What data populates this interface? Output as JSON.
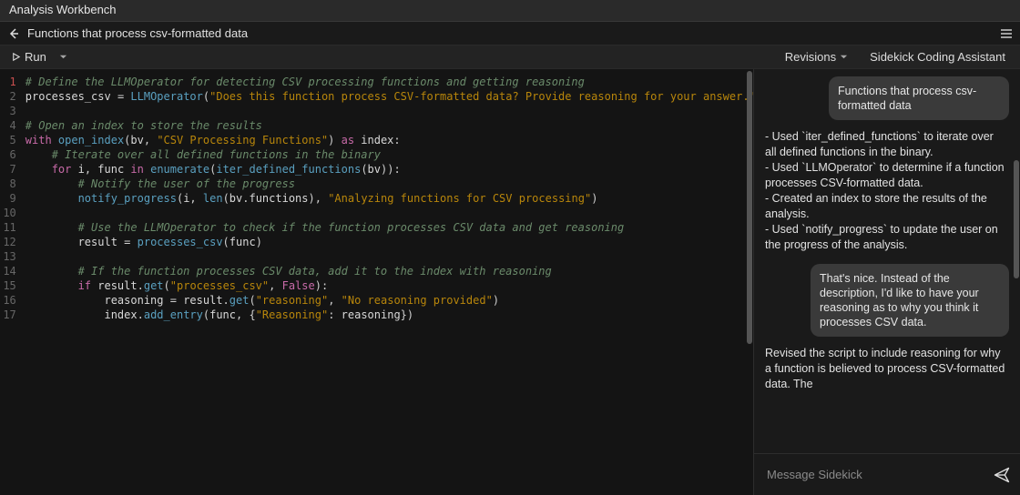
{
  "app": {
    "title": "Analysis Workbench"
  },
  "doc": {
    "title": "Functions that process csv-formatted data"
  },
  "toolbar": {
    "run_label": "Run",
    "revisions_label": "Revisions",
    "assistant_title": "Sidekick Coding Assistant"
  },
  "code_lines": [
    [
      [
        "com",
        "# Define the LLMOperator for detecting CSV processing functions and getting reasoning"
      ]
    ],
    [
      [
        "id",
        "processes_csv "
      ],
      [
        "op",
        "="
      ],
      [
        "id",
        " "
      ],
      [
        "fn",
        "LLMOperator"
      ],
      [
        "op",
        "("
      ],
      [
        "str",
        "\"Does this function process CSV-formatted data? Provide reasoning for your answer.\""
      ],
      [
        "op",
        ")"
      ]
    ],
    [],
    [
      [
        "com",
        "# Open an index to store the results"
      ]
    ],
    [
      [
        "kw",
        "with"
      ],
      [
        "id",
        " "
      ],
      [
        "fn",
        "open_index"
      ],
      [
        "op",
        "("
      ],
      [
        "id",
        "bv"
      ],
      [
        "op",
        ", "
      ],
      [
        "str",
        "\"CSV Processing Functions\""
      ],
      [
        "op",
        ") "
      ],
      [
        "kw",
        "as"
      ],
      [
        "id",
        " index"
      ],
      [
        "op",
        ":"
      ]
    ],
    [
      [
        "id",
        "    "
      ],
      [
        "com",
        "# Iterate over all defined functions in the binary"
      ]
    ],
    [
      [
        "id",
        "    "
      ],
      [
        "kw",
        "for"
      ],
      [
        "id",
        " i"
      ],
      [
        "op",
        ", "
      ],
      [
        "id",
        "func "
      ],
      [
        "kw",
        "in"
      ],
      [
        "id",
        " "
      ],
      [
        "fn",
        "enumerate"
      ],
      [
        "op",
        "("
      ],
      [
        "fn",
        "iter_defined_functions"
      ],
      [
        "op",
        "("
      ],
      [
        "id",
        "bv"
      ],
      [
        "op",
        ")):"
      ]
    ],
    [
      [
        "id",
        "        "
      ],
      [
        "com",
        "# Notify the user of the progress"
      ]
    ],
    [
      [
        "id",
        "        "
      ],
      [
        "fn",
        "notify_progress"
      ],
      [
        "op",
        "("
      ],
      [
        "id",
        "i"
      ],
      [
        "op",
        ", "
      ],
      [
        "fn",
        "len"
      ],
      [
        "op",
        "("
      ],
      [
        "id",
        "bv"
      ],
      [
        "op",
        "."
      ],
      [
        "id",
        "functions"
      ],
      [
        "op",
        "), "
      ],
      [
        "str",
        "\"Analyzing functions for CSV processing\""
      ],
      [
        "op",
        ")"
      ]
    ],
    [],
    [
      [
        "id",
        "        "
      ],
      [
        "com",
        "# Use the LLMOperator to check if the function processes CSV data and get reasoning"
      ]
    ],
    [
      [
        "id",
        "        "
      ],
      [
        "id",
        "result "
      ],
      [
        "op",
        "="
      ],
      [
        "id",
        " "
      ],
      [
        "fn",
        "processes_csv"
      ],
      [
        "op",
        "("
      ],
      [
        "id",
        "func"
      ],
      [
        "op",
        ")"
      ]
    ],
    [],
    [
      [
        "id",
        "        "
      ],
      [
        "com",
        "# If the function processes CSV data, add it to the index with reasoning"
      ]
    ],
    [
      [
        "id",
        "        "
      ],
      [
        "kw",
        "if"
      ],
      [
        "id",
        " result"
      ],
      [
        "op",
        "."
      ],
      [
        "fn",
        "get"
      ],
      [
        "op",
        "("
      ],
      [
        "str",
        "\"processes_csv\""
      ],
      [
        "op",
        ", "
      ],
      [
        "bool",
        "False"
      ],
      [
        "op",
        "):"
      ]
    ],
    [
      [
        "id",
        "            "
      ],
      [
        "id",
        "reasoning "
      ],
      [
        "op",
        "="
      ],
      [
        "id",
        " result"
      ],
      [
        "op",
        "."
      ],
      [
        "fn",
        "get"
      ],
      [
        "op",
        "("
      ],
      [
        "str",
        "\"reasoning\""
      ],
      [
        "op",
        ", "
      ],
      [
        "str",
        "\"No reasoning provided\""
      ],
      [
        "op",
        ")"
      ]
    ],
    [
      [
        "id",
        "            "
      ],
      [
        "id",
        "index"
      ],
      [
        "op",
        "."
      ],
      [
        "fn",
        "add_entry"
      ],
      [
        "op",
        "("
      ],
      [
        "id",
        "func"
      ],
      [
        "op",
        ", {"
      ],
      [
        "str",
        "\"Reasoning\""
      ],
      [
        "op",
        ": "
      ],
      [
        "id",
        "reasoning"
      ],
      [
        "op",
        "})"
      ]
    ]
  ],
  "chat": {
    "user1": "Functions that process csv-formatted data",
    "assist1": "- Used `iter_defined_functions` to iterate over all defined functions in the binary.\n- Used `LLMOperator` to determine if a function processes CSV-formatted data.\n- Created an index to store the results of the analysis.\n- Used `notify_progress` to update the user on the progress of the analysis.",
    "user2": "That's nice. Instead of the description, I'd like to have your reasoning as to why you think it processes CSV data.",
    "assist2": "Revised the script to include reasoning for why a function is believed to process CSV-formatted data. The",
    "input_placeholder": "Message Sidekick"
  }
}
